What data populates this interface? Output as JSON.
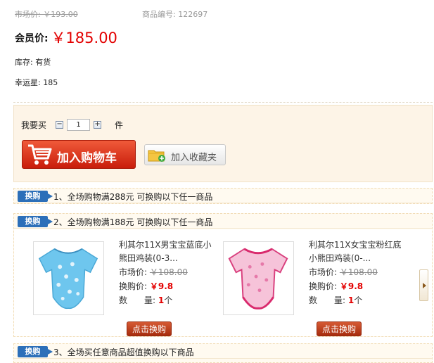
{
  "top": {
    "market_price": "市场价: ￥193.00",
    "sku": "商品编号: 122697"
  },
  "member": {
    "label": "会员价:",
    "price": "￥185.00"
  },
  "stock": "库存: 有货",
  "lucky": "幸运星: 185",
  "purchase": {
    "want_label": "我要买",
    "minus": "−",
    "quantity": "1",
    "plus": "+",
    "unit": "件",
    "add_cart_label": "加入购物车",
    "add_fav_label": "加入收藏夹"
  },
  "promotions": [
    {
      "tag": "换购",
      "title": "1、全场购物满288元 可换购以下任一商品"
    },
    {
      "tag": "换购",
      "title": "2、全场购物满188元 可换购以下任一商品"
    },
    {
      "tag": "换购",
      "title": "3、全场买任意商品超值换购以下商品"
    }
  ],
  "products": [
    {
      "name": "利其尔11X男宝宝蓝底小熊田鸡装(0-3...",
      "market_label": "市场价:",
      "market_value": "￥108.00",
      "swap_label": "换购价:",
      "swap_value": "￥9.8",
      "qty_label": "数　　量:",
      "qty_value": "1",
      "qty_unit": "个",
      "button": "点击换购",
      "image_color": "#6ec6ee"
    },
    {
      "name": "利其尔11X女宝宝粉红底小熊田鸡装(0-...",
      "market_label": "市场价:",
      "market_value": "￥108.00",
      "swap_label": "换购价:",
      "swap_value": "￥9.8",
      "qty_label": "数　　量:",
      "qty_value": "1",
      "qty_unit": "个",
      "button": "点击换购",
      "image_color": "#f6b7d2"
    }
  ],
  "colors": {
    "price_red": "#e30000",
    "tag_blue": "#2c6fb9",
    "cart_red": "#d8361c"
  }
}
